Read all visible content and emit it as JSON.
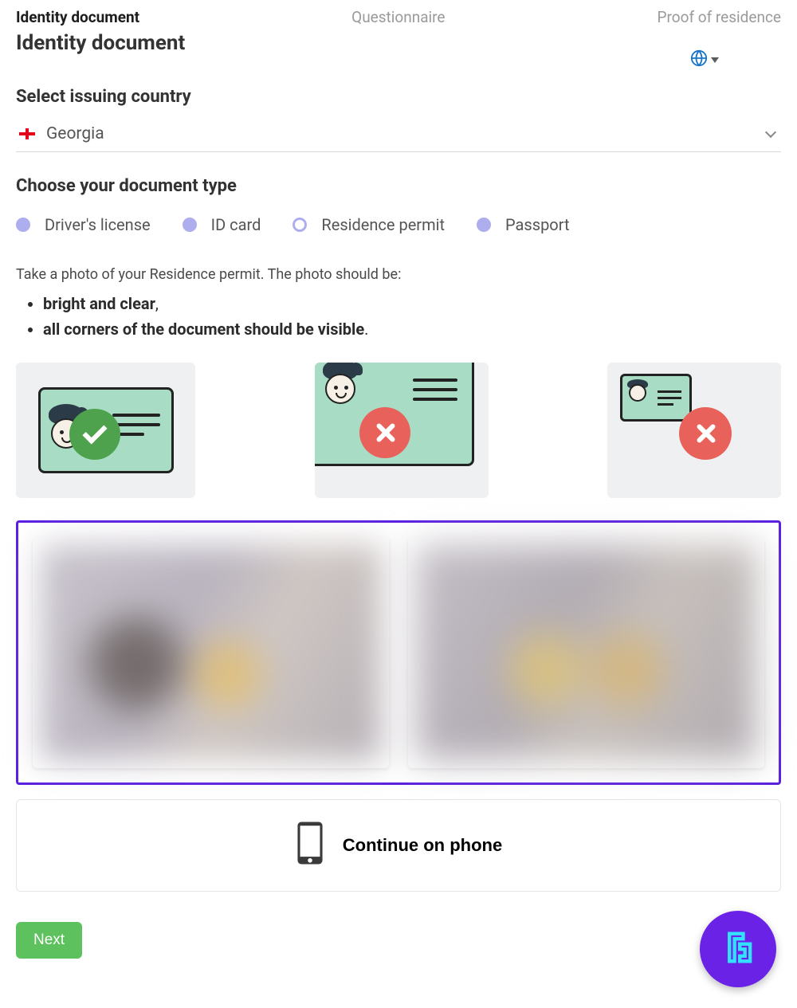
{
  "stepper": {
    "step1": "Identity document",
    "step2": "Questionnaire",
    "step3": "Proof of residence"
  },
  "page_title": "Identity document",
  "country": {
    "label": "Select issuing country",
    "selected": "Georgia"
  },
  "doc_type": {
    "label": "Choose your document type",
    "options": {
      "drivers_license": "Driver's license",
      "id_card": "ID card",
      "residence_permit": "Residence permit",
      "passport": "Passport"
    },
    "selected": "residence_permit"
  },
  "instructions": {
    "intro": "Take a photo of your Residence permit. The photo should be:",
    "req1": "bright and clear",
    "req1_tail": ",",
    "req2": "all corners of the document should be visible",
    "req2_tail": "."
  },
  "continue_phone": "Continue on phone",
  "next": "Next"
}
